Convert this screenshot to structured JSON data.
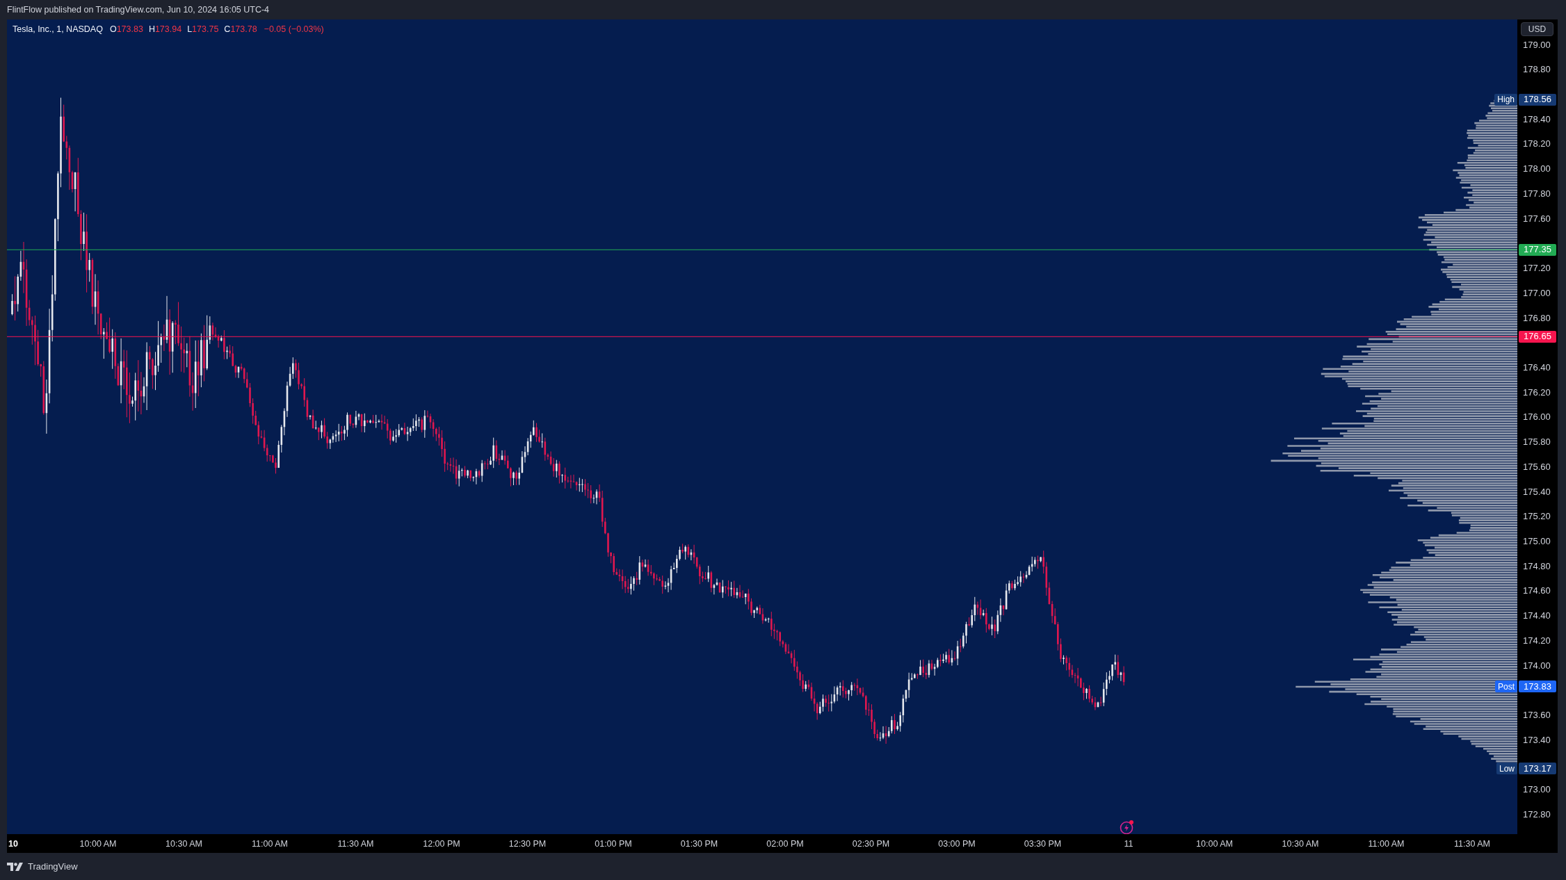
{
  "header": {
    "publisher_line": "FlintFlow published on TradingView.com, Jun 10, 2024 16:05 UTC-4"
  },
  "legend": {
    "symbol": "Tesla, Inc., 1, NASDAQ",
    "ohlc": [
      {
        "label": "O",
        "value": "173.83"
      },
      {
        "label": "H",
        "value": "173.94"
      },
      {
        "label": "L",
        "value": "173.75"
      },
      {
        "label": "C",
        "value": "173.78"
      }
    ],
    "change": "−0.05 (−0.03%)"
  },
  "currency_button": "USD",
  "price_axis": {
    "ticks": [
      "179.00",
      "178.80",
      "178.40",
      "178.20",
      "178.00",
      "177.80",
      "177.60",
      "177.20",
      "177.00",
      "176.80",
      "176.40",
      "176.20",
      "176.00",
      "175.80",
      "175.60",
      "175.40",
      "175.20",
      "175.00",
      "174.80",
      "174.60",
      "174.40",
      "174.20",
      "174.00",
      "173.60",
      "173.40",
      "173.00",
      "172.80"
    ]
  },
  "price_lines": [
    {
      "value": "177.35",
      "color": "#22ab54"
    },
    {
      "value": "176.65",
      "color": "#f7154e"
    }
  ],
  "price_labels": [
    {
      "label": "High",
      "value": "178.56",
      "color": "#163a73"
    },
    {
      "label": "Post",
      "value": "173.83",
      "color": "#1e66f5"
    },
    {
      "label": "Low",
      "value": "173.17",
      "color": "#163a73"
    }
  ],
  "time_axis": {
    "ticks": [
      {
        "label": "10",
        "bold": true
      },
      {
        "label": "10:00 AM",
        "bold": false
      },
      {
        "label": "10:30 AM",
        "bold": false
      },
      {
        "label": "11:00 AM",
        "bold": false
      },
      {
        "label": "11:30 AM",
        "bold": false
      },
      {
        "label": "12:00 PM",
        "bold": false
      },
      {
        "label": "12:30 PM",
        "bold": false
      },
      {
        "label": "01:00 PM",
        "bold": false
      },
      {
        "label": "01:30 PM",
        "bold": false
      },
      {
        "label": "02:00 PM",
        "bold": false
      },
      {
        "label": "02:30 PM",
        "bold": false
      },
      {
        "label": "03:00 PM",
        "bold": false
      },
      {
        "label": "03:30 PM",
        "bold": false
      },
      {
        "label": "11",
        "bold": false
      },
      {
        "label": "10:00 AM",
        "bold": false
      },
      {
        "label": "10:30 AM",
        "bold": false
      },
      {
        "label": "11:00 AM",
        "bold": false
      },
      {
        "label": "11:30 AM",
        "bold": false
      }
    ]
  },
  "footer": {
    "brand": "TradingView"
  }
}
